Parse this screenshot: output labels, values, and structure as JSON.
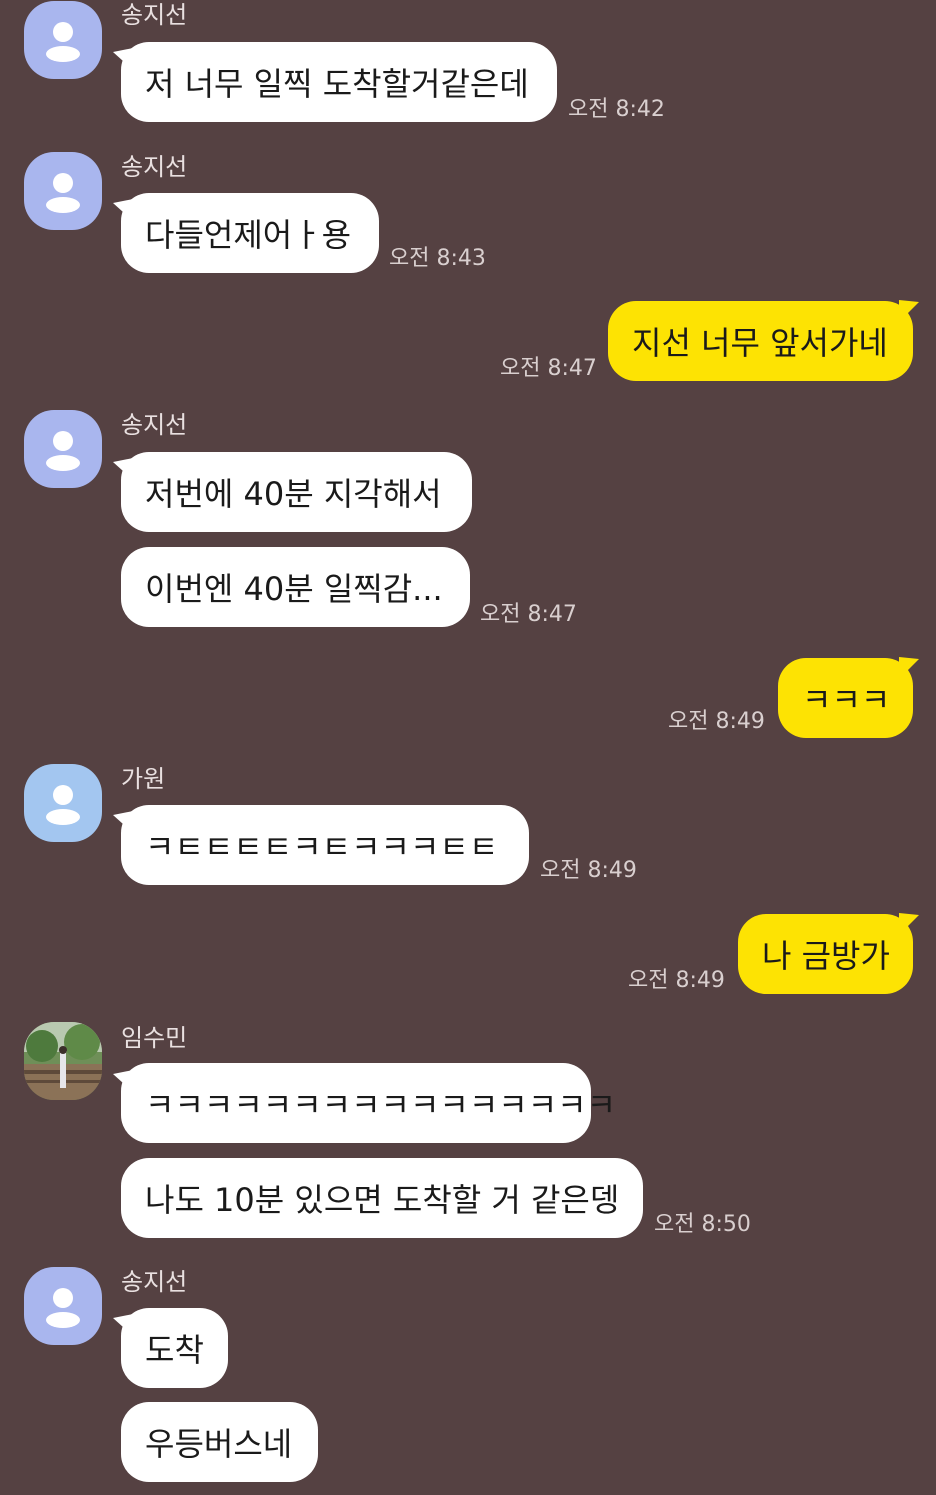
{
  "colors": {
    "background": "#554142",
    "incoming_bubble": "#ffffff",
    "outgoing_bubble": "#fde303",
    "avatar_default": "#a9b6ee",
    "avatar_alt": "#a3c6f0"
  },
  "messages": [
    {
      "sender": "송지선",
      "text": "저 너무 일찍 도착할거같은데",
      "time": "오전 8:42"
    },
    {
      "sender": "송지선",
      "text": "다들언제어ㅏ용",
      "time": "오전 8:43"
    },
    {
      "sender": "me",
      "text": "지선 너무 앞서가네",
      "time": "오전 8:47"
    },
    {
      "sender": "송지선",
      "text": "저번에 40분 지각해서"
    },
    {
      "sender": "송지선",
      "text": "이번엔 40분 일찍감...",
      "time": "오전 8:47"
    },
    {
      "sender": "me",
      "text": "ㅋㅋㅋ",
      "time": "오전 8:49"
    },
    {
      "sender": "가원",
      "text": "ㅋㅌㅌㅌㅌㅋㅌㅋㅋㅋㅌㅌ",
      "time": "오전 8:49"
    },
    {
      "sender": "me",
      "text": "나 금방가",
      "time": "오전 8:49"
    },
    {
      "sender": "임수민",
      "text": "ㅋㅋㅋㅋㅋㅋㅋㅋㅋㅋㅋㅋㅋㅋㅋㅋ"
    },
    {
      "sender": "임수민",
      "text": "나도 10분 있으면 도착할 거 같은뎅",
      "time": "오전 8:50"
    },
    {
      "sender": "송지선",
      "text": "도착"
    },
    {
      "sender": "송지선",
      "text": "우등버스네"
    }
  ]
}
